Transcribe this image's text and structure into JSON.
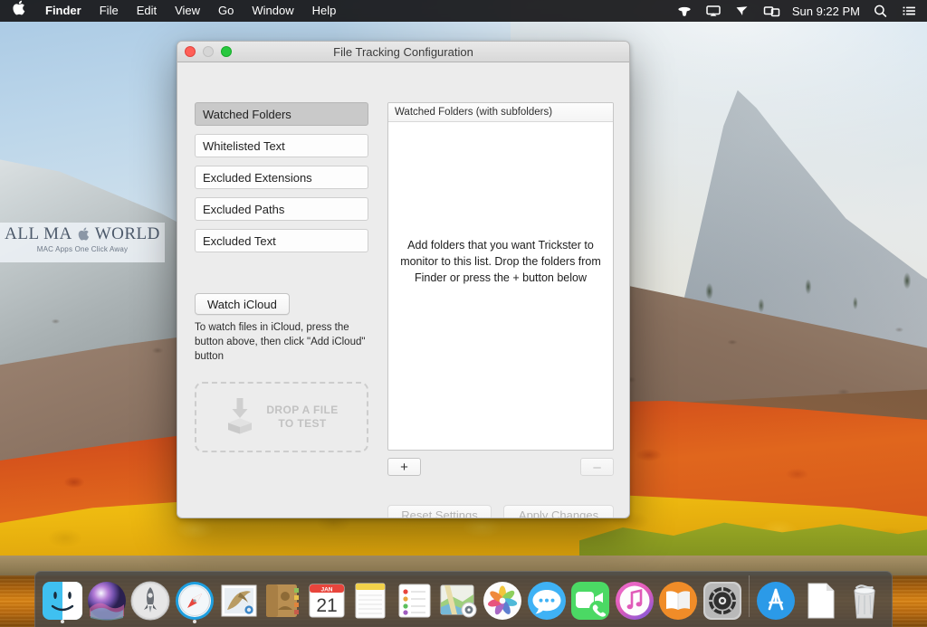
{
  "menubar": {
    "apple_icon": "apple-logo-icon",
    "items": [
      {
        "label": "Finder",
        "bold": true
      },
      {
        "label": "File",
        "bold": false
      },
      {
        "label": "Edit",
        "bold": false
      },
      {
        "label": "View",
        "bold": false
      },
      {
        "label": "Go",
        "bold": false
      },
      {
        "label": "Window",
        "bold": false
      },
      {
        "label": "Help",
        "bold": false
      }
    ],
    "status_icons": [
      "dropbox-icon",
      "airplay-display-icon",
      "vpn-icon",
      "screen-sharing-icon"
    ],
    "clock": "Sun 9:22 PM",
    "search_icon": "search-icon",
    "notification_center_icon": "notification-center-icon"
  },
  "watermark": {
    "line1_a": "ALL MA",
    "line1_b": "WORLD",
    "apple_glyph": "",
    "line2": "MAC Apps One Click Away"
  },
  "window": {
    "title": "File Tracking Configuration",
    "traffic": {
      "close": "close-button",
      "minimize": "minimize-button",
      "zoom": "zoom-button"
    },
    "categories": [
      {
        "label": "Watched Folders",
        "selected": true
      },
      {
        "label": "Whitelisted Text",
        "selected": false
      },
      {
        "label": "Excluded Extensions",
        "selected": false
      },
      {
        "label": "Excluded Paths",
        "selected": false
      },
      {
        "label": "Excluded Text",
        "selected": false
      }
    ],
    "icloud_button": "Watch iCloud",
    "icloud_help": "To watch files in iCloud, press the button above, then click \"Add iCloud\" button",
    "dropzone": {
      "line1": "DROP A FILE",
      "line2": "TO TEST",
      "icon": "download-to-box-icon"
    },
    "list": {
      "header": "Watched Folders (with subfolders)",
      "empty_message": "Add folders that you want Trickster to monitor to this list. Drop the folders from Finder or press the + button below",
      "rows": []
    },
    "add_button": "+",
    "remove_button": "–",
    "reset_button": "Reset Settings",
    "apply_button": "Apply Changes"
  },
  "dock": {
    "items": [
      {
        "name": "finder",
        "label": "Finder",
        "running": true
      },
      {
        "name": "siri",
        "label": "Siri",
        "running": false
      },
      {
        "name": "launchpad",
        "label": "Launchpad",
        "running": false
      },
      {
        "name": "safari",
        "label": "Safari",
        "running": true
      },
      {
        "name": "mail",
        "label": "Mail",
        "running": false
      },
      {
        "name": "contacts",
        "label": "Contacts",
        "running": false
      },
      {
        "name": "calendar",
        "label": "Calendar",
        "running": false,
        "month": "JAN",
        "day": "21"
      },
      {
        "name": "notes",
        "label": "Notes",
        "running": false
      },
      {
        "name": "reminders",
        "label": "Reminders",
        "running": false
      },
      {
        "name": "maps",
        "label": "Maps",
        "running": false
      },
      {
        "name": "photos",
        "label": "Photos",
        "running": false
      },
      {
        "name": "messages",
        "label": "Messages",
        "running": false
      },
      {
        "name": "facetime",
        "label": "FaceTime",
        "running": false
      },
      {
        "name": "itunes",
        "label": "iTunes",
        "running": false
      },
      {
        "name": "ibooks",
        "label": "iBooks",
        "running": false
      },
      {
        "name": "system-preferences",
        "label": "System Preferences",
        "running": false
      }
    ],
    "items_right": [
      {
        "name": "app-store",
        "label": "App Store",
        "running": false
      },
      {
        "name": "documents",
        "label": "Documents",
        "running": false
      },
      {
        "name": "trash",
        "label": "Trash",
        "running": false
      }
    ]
  },
  "colors": {
    "accent_blue": "#3b7fd4",
    "close_red": "#ff5f57",
    "zoom_green": "#28c840",
    "disabled_gray": "#b4b4b4",
    "window_bg": "#ececec",
    "selected_row": "#c9c9c9"
  }
}
